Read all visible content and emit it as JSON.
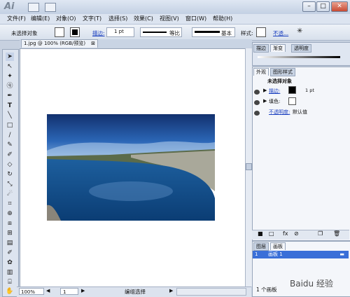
{
  "app": {
    "logo": "Ai"
  },
  "menu": [
    "文件(F)",
    "编辑(E)",
    "对象(O)",
    "文字(T)",
    "选择(S)",
    "效果(C)",
    "视图(V)",
    "窗口(W)",
    "帮助(H)"
  ],
  "control": {
    "selection": "未选择对象",
    "stroke_label": "描边:",
    "stroke_weight": "1 pt",
    "profile": "等比",
    "brush": "基本",
    "style_label": "样式:",
    "opacity_link": "不透..."
  },
  "document": {
    "tab": "1.jpg @ 100% (RGB/预览)"
  },
  "status": {
    "zoom": "100%",
    "page": "1",
    "tool": "编组选择"
  },
  "panel_top": {
    "tabs": [
      "描边",
      "渐变",
      "透明度"
    ]
  },
  "appearance": {
    "tabs": [
      "外观",
      "图形样式"
    ],
    "title": "未选择对象",
    "stroke": "描边:",
    "stroke_weight": "1 pt",
    "fill": "填色:",
    "opacity_label": "不透明度:",
    "opacity_value": "默认值"
  },
  "artboards": {
    "tabs": [
      "图层",
      "画板"
    ],
    "item_index": "1",
    "item_name": "画板 1",
    "count": "1 个画板"
  },
  "watermark": "Baidu 经验",
  "colors": {
    "accent": "#3a6fd8",
    "panel_bg": "#dde4ef"
  }
}
